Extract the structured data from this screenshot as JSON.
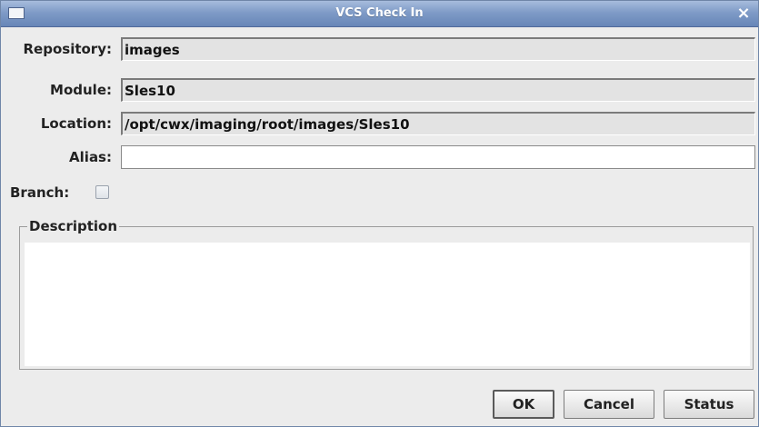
{
  "window": {
    "title": "VCS Check In",
    "close_glyph": "×"
  },
  "form": {
    "repository": {
      "label": "Repository:",
      "value": "images"
    },
    "module": {
      "label": "Module:",
      "value": "Sles10"
    },
    "location": {
      "label": "Location:",
      "value": "/opt/cwx/imaging/root/images/Sles10"
    },
    "alias": {
      "label": "Alias:",
      "value": ""
    },
    "branch": {
      "label": "Branch:",
      "checked": false
    }
  },
  "description": {
    "legend": "Description",
    "value": ""
  },
  "buttons": {
    "ok": "OK",
    "cancel": "Cancel",
    "status": "Status"
  },
  "icons": {
    "window_menu": "window-menu-icon",
    "close": "close-icon"
  }
}
